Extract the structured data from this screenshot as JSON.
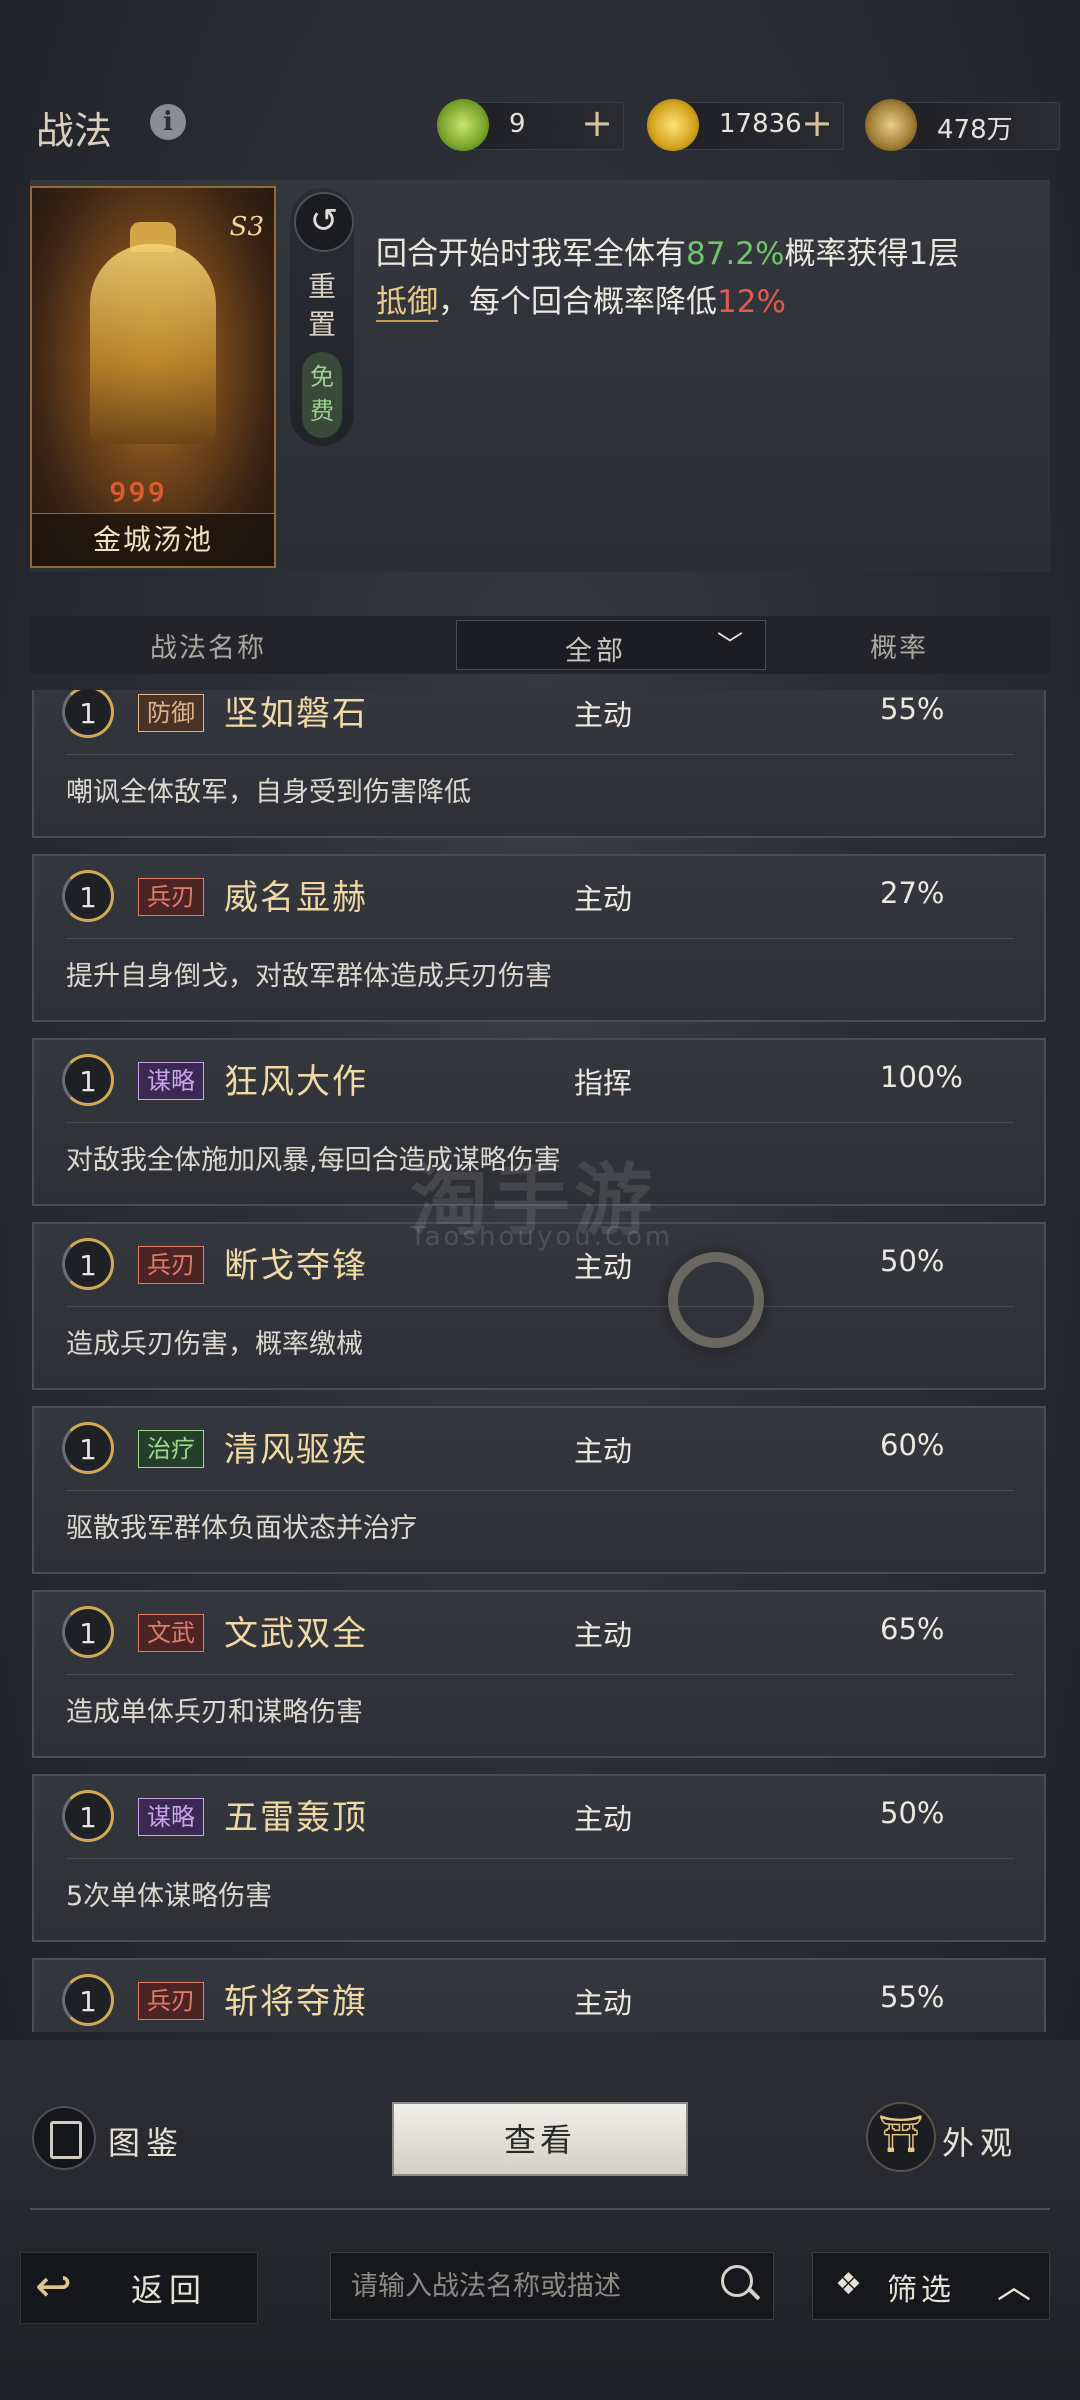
{
  "header": {
    "title": "战法",
    "info_icon": "info-icon",
    "resources": [
      {
        "icon": "jade-coin-icon",
        "value": "9",
        "color": "#8fbf3a"
      },
      {
        "icon": "gold-coin-icon",
        "value": "17836",
        "color": "#e6c13a"
      },
      {
        "icon": "copper-coin-icon",
        "value": "478万",
        "color": "#c9a85a"
      }
    ],
    "plus": "+"
  },
  "featured": {
    "card_name": "金城汤池",
    "season": "S3",
    "reset_label_1": "重",
    "reset_label_2": "置",
    "free_1": "免",
    "free_2": "费",
    "desc_part1": "回合开始时我军全体有",
    "desc_rate": "87.2%",
    "desc_part2": "概率获得1层",
    "desc_keyword": "抵御",
    "desc_part3": "，每个回合概率降低",
    "desc_decay": "12%"
  },
  "filter": {
    "col_name": "战法名称",
    "dropdown_value": "全部",
    "col_rate": "概率"
  },
  "tactics": [
    {
      "level": "1",
      "tag": "防御",
      "name": "坚如磐石",
      "kind": "主动",
      "rate": "55%",
      "desc": "嘲讽全体敌军，自身受到伤害降低"
    },
    {
      "level": "1",
      "tag": "兵刃",
      "name": "威名显赫",
      "kind": "主动",
      "rate": "27%",
      "desc": "提升自身倒戈，对敌军群体造成兵刃伤害"
    },
    {
      "level": "1",
      "tag": "谋略",
      "name": "狂风大作",
      "kind": "指挥",
      "rate": "100%",
      "desc": "对敌我全体施加风暴,每回合造成谋略伤害"
    },
    {
      "level": "1",
      "tag": "兵刃",
      "name": "断戈夺锋",
      "kind": "主动",
      "rate": "50%",
      "desc": "造成兵刃伤害，概率缴械"
    },
    {
      "level": "1",
      "tag": "治疗",
      "name": "清风驱疾",
      "kind": "主动",
      "rate": "60%",
      "desc": "驱散我军群体负面状态并治疗"
    },
    {
      "level": "1",
      "tag": "文武",
      "name": "文武双全",
      "kind": "主动",
      "rate": "65%",
      "desc": "造成单体兵刃和谋略伤害"
    },
    {
      "level": "1",
      "tag": "谋略",
      "name": "五雷轰顶",
      "kind": "主动",
      "rate": "50%",
      "desc": "5次单体谋略伤害"
    },
    {
      "level": "1",
      "tag": "兵刃",
      "name": "斩将夺旗",
      "kind": "主动",
      "rate": "55%",
      "desc": ""
    }
  ],
  "watermark": {
    "cn": "淘手游",
    "en": "Taoshouyou.Com"
  },
  "bottom": {
    "codex_label": "图鉴",
    "view_label": "查看",
    "appearance_label": "外观",
    "back_label": "返回",
    "search_placeholder": "请输入战法名称或描述",
    "filter_label": "筛选"
  }
}
